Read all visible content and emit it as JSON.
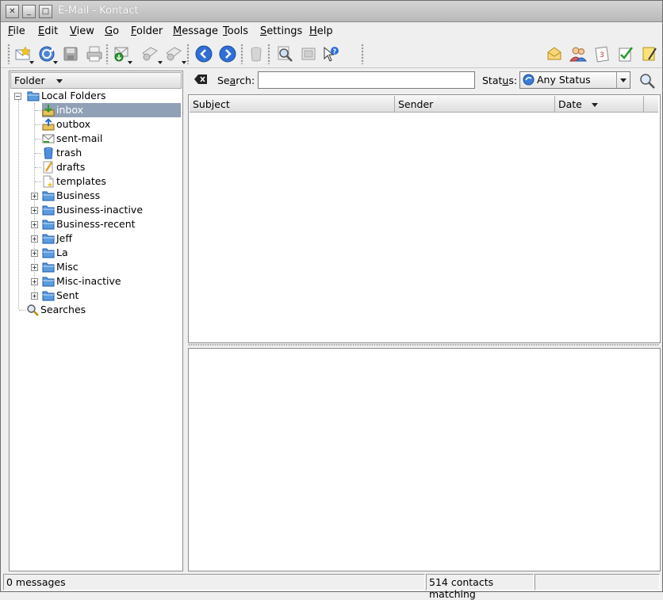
{
  "window": {
    "title": "E-Mail - Kontact"
  },
  "menubar": {
    "items": [
      {
        "label": "File",
        "u": "F",
        "rest": "ile"
      },
      {
        "label": "Edit",
        "u": "E",
        "rest": "dit"
      },
      {
        "label": "View",
        "u": "V",
        "rest": "iew"
      },
      {
        "label": "Go",
        "u": "G",
        "rest": "o"
      },
      {
        "label": "Folder",
        "u": "F",
        "rest": "older"
      },
      {
        "label": "Message",
        "u": "M",
        "rest": "essage"
      },
      {
        "label": "Tools",
        "u": "T",
        "rest": "ools"
      },
      {
        "label": "Settings",
        "u": "S",
        "rest": "ettings"
      },
      {
        "label": "Help",
        "u": "H",
        "rest": "elp"
      }
    ]
  },
  "toolbar": {
    "icons": [
      "new-message-icon",
      "check-mail-icon",
      "save-icon",
      "print-icon",
      "reply-icon",
      "forward-icon",
      "forward-alt-icon",
      "back-icon",
      "forward-nav-icon",
      "trash-icon",
      "find-icon",
      "watch-icon",
      "whats-this-icon"
    ],
    "right_icons": [
      "mail-component-icon",
      "contacts-component-icon",
      "calendar-component-icon",
      "todo-component-icon",
      "notes-component-icon"
    ]
  },
  "folder_pane": {
    "header": "Folder",
    "root": "Local Folders",
    "folders": [
      {
        "label": "inbox",
        "icon": "inbox-icon",
        "selected": true,
        "expandable": false
      },
      {
        "label": "outbox",
        "icon": "outbox-icon",
        "selected": false,
        "expandable": false
      },
      {
        "label": "sent-mail",
        "icon": "sent-mail-icon",
        "selected": false,
        "expandable": false
      },
      {
        "label": "trash",
        "icon": "trash-folder-icon",
        "selected": false,
        "expandable": false
      },
      {
        "label": "drafts",
        "icon": "drafts-icon",
        "selected": false,
        "expandable": false
      },
      {
        "label": "templates",
        "icon": "templates-icon",
        "selected": false,
        "expandable": false
      },
      {
        "label": "Business",
        "icon": "folder-icon",
        "selected": false,
        "expandable": true
      },
      {
        "label": "Business-inactive",
        "icon": "folder-icon",
        "selected": false,
        "expandable": true
      },
      {
        "label": "Business-recent",
        "icon": "folder-icon",
        "selected": false,
        "expandable": true
      },
      {
        "label": "Jeff",
        "icon": "folder-icon",
        "selected": false,
        "expandable": true
      },
      {
        "label": "La",
        "icon": "folder-icon",
        "selected": false,
        "expandable": true
      },
      {
        "label": "Misc",
        "icon": "folder-icon",
        "selected": false,
        "expandable": true
      },
      {
        "label": "Misc-inactive",
        "icon": "folder-icon",
        "selected": false,
        "expandable": true
      },
      {
        "label": "Sent",
        "icon": "folder-icon",
        "selected": false,
        "expandable": true
      }
    ],
    "searches": "Searches"
  },
  "search": {
    "label_pre": "Se",
    "label_u": "a",
    "label_post": "rch:",
    "value": "",
    "status_pre": "Stat",
    "status_u": "u",
    "status_post": "s:",
    "status_value": "Any Status"
  },
  "message_list": {
    "columns": [
      "Subject",
      "Sender",
      "Date"
    ]
  },
  "statusbar": {
    "messages": "0 messages",
    "contacts": "514 contacts matching",
    "extra": ""
  },
  "colors": {
    "selection": "#90a0b6",
    "title_bar": "#c4c4c4",
    "accent_blue": "#2a6bd0"
  }
}
